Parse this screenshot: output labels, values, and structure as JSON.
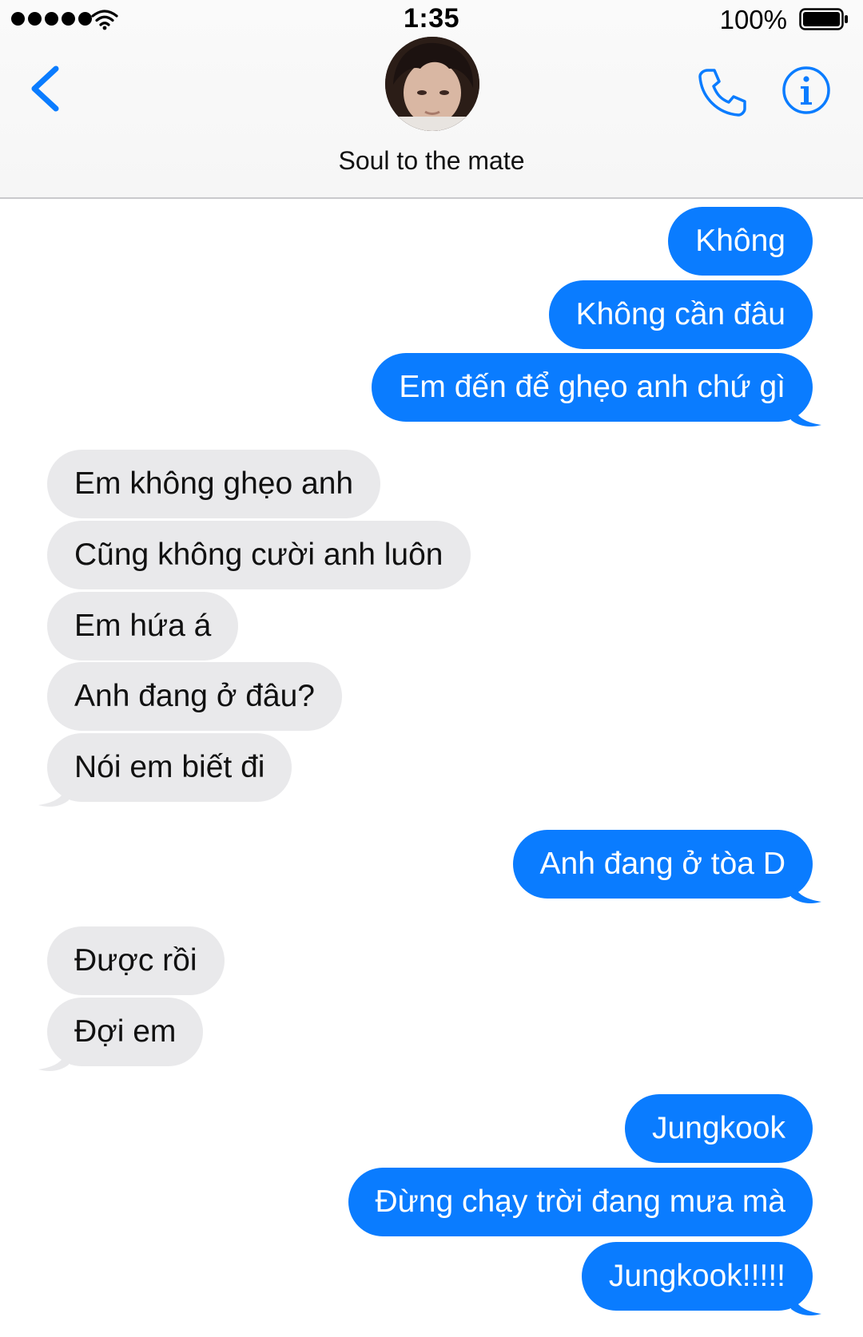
{
  "status_bar": {
    "time": "1:35",
    "battery": "100%"
  },
  "header": {
    "contact_name": "Soul to the mate"
  },
  "icons": {
    "back": "chevron-left-icon",
    "phone": "phone-icon",
    "info": "info-icon",
    "wifi": "wifi-icon",
    "battery": "battery-icon",
    "signal": "signal-dots-icon"
  },
  "colors": {
    "sent_bubble": "#0a7cff",
    "received_bubble": "#e9e9eb",
    "accent": "#0a7cff"
  },
  "messages": [
    {
      "sender": "me",
      "text": "Không"
    },
    {
      "sender": "me",
      "text": "Không cần đâu"
    },
    {
      "sender": "me",
      "text": "Em đến để ghẹo anh chứ gì"
    },
    {
      "sender": "them",
      "text": "Em không ghẹo anh"
    },
    {
      "sender": "them",
      "text": "Cũng không cười anh luôn"
    },
    {
      "sender": "them",
      "text": "Em hứa á"
    },
    {
      "sender": "them",
      "text": "Anh đang ở đâu?"
    },
    {
      "sender": "them",
      "text": "Nói em biết đi"
    },
    {
      "sender": "me",
      "text": "Anh đang ở tòa D"
    },
    {
      "sender": "them",
      "text": "Được rồi"
    },
    {
      "sender": "them",
      "text": "Đợi em"
    },
    {
      "sender": "me",
      "text": "Jungkook"
    },
    {
      "sender": "me",
      "text": "Đừng chạy trời đang mưa mà"
    },
    {
      "sender": "me",
      "text": "Jungkook!!!!!"
    }
  ]
}
